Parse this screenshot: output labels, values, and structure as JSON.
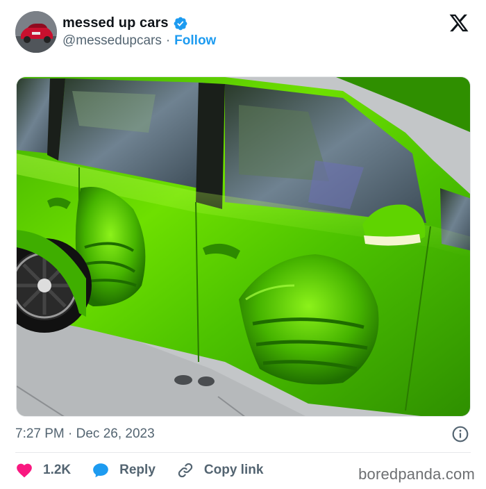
{
  "account": {
    "display_name": "messed up cars",
    "handle": "@messedupcars",
    "separator": "·",
    "follow_label": "Follow",
    "verified": true
  },
  "platform_logo": "x-logo-icon",
  "post": {
    "timestamp": "7:27 PM · Dec 26, 2023"
  },
  "actions": {
    "like_count": "1.2K",
    "reply_label": "Reply",
    "copy_link_label": "Copy link"
  },
  "watermark": "boredpanda.com",
  "colors": {
    "link_blue": "#1d9bf0",
    "like_red": "#f91880",
    "text_primary": "#0f1419",
    "text_secondary": "#536471",
    "car_green": "#5fd400"
  },
  "icons": [
    "verified-badge-icon",
    "x-logo-icon",
    "info-icon",
    "heart-icon",
    "reply-bubble-icon",
    "link-icon"
  ]
}
